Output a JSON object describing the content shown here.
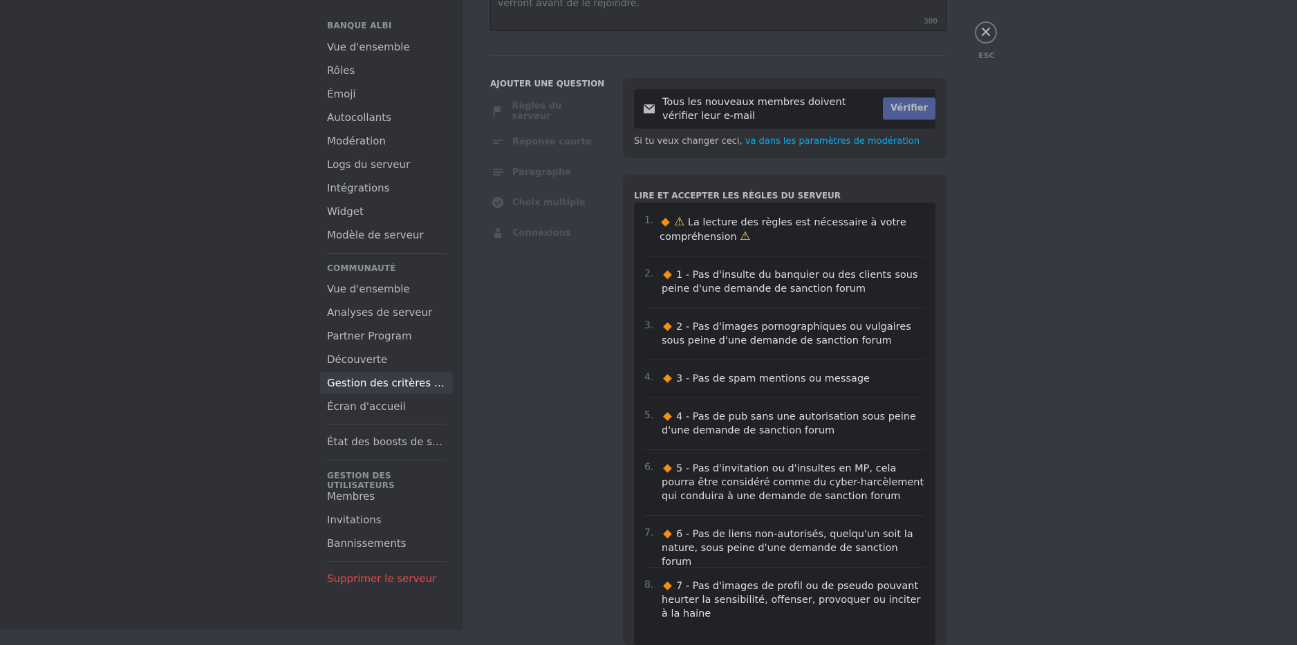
{
  "sidebar": {
    "sections": [
      {
        "header": "BANQUE ALBI",
        "items": [
          "Vue d'ensemble",
          "Rôles",
          "Émoji",
          "Autocollants",
          "Modération",
          "Logs du serveur",
          "Intégrations",
          "Widget",
          "Modèle de serveur"
        ]
      },
      {
        "header": "COMMUNAUTÉ",
        "items": [
          "Vue d'ensemble",
          "Analyses de serveur",
          "Partner Program",
          "Découverte",
          "Gestion des critères de ...",
          "Écran d'accueil"
        ]
      },
      {
        "items": [
          "État des boosts de serveur"
        ]
      },
      {
        "header": "GESTION DES UTILISATEURS",
        "items": [
          "Membres",
          "Invitations",
          "Bannissements"
        ]
      },
      {
        "items": [
          "Supprimer le serveur"
        ]
      }
    ],
    "active_item": "Gestion des critères de ..."
  },
  "description": {
    "text": "verront avant de le rejoindre.",
    "char_count": "300"
  },
  "add_question": {
    "header": "AJOUTER UNE QUESTION",
    "types": [
      {
        "label": "Règles du serveur",
        "icon": "flag-icon"
      },
      {
        "label": "Réponse courte",
        "icon": "short-text-icon"
      },
      {
        "label": "Paragraphe",
        "icon": "paragraph-icon"
      },
      {
        "label": "Choix multiple",
        "icon": "check-circle-icon"
      },
      {
        "label": "Connexions",
        "icon": "connections-icon"
      }
    ]
  },
  "verify_card": {
    "text": "Tous les nouveaux membres doivent vérifier leur e-mail",
    "button": "Vérifier",
    "hint_prefix": "Si tu veux changer ceci, ",
    "hint_link": "va dans les paramètres de modération"
  },
  "rules": {
    "title": "LIRE ET ACCEPTER LES RÈGLES DU SERVEUR",
    "items": [
      {
        "num": "1.",
        "text": "La lecture des règles est nécessaire à votre compréhension"
      },
      {
        "num": "2.",
        "text": "1 - Pas d'insulte du banquier ou des clients sous peine d'une demande de sanction forum"
      },
      {
        "num": "3.",
        "text": "2 - Pas d'images pornographiques ou vulgaires sous peine d'une demande de sanction forum"
      },
      {
        "num": "4.",
        "text": "3 - Pas de spam mentions ou message"
      },
      {
        "num": "5.",
        "text": "4 - Pas de pub sans une autorisation sous peine d'une demande de sanction forum"
      },
      {
        "num": "6.",
        "text": "5 - Pas d'invitation ou d'insultes en MP, cela pourra être considéré comme du cyber-harcèlement qui conduira à une demande de sanction forum"
      },
      {
        "num": "7.",
        "text": "6 - Pas de liens non-autorisés, quelqu'un soit la nature, sous peine d'une demande de sanction forum"
      },
      {
        "num": "8.",
        "text": "7 - Pas d'images de profil ou de pseudo pouvant heurter la sensibilité, offenser, provoquer ou inciter à la haine"
      }
    ]
  },
  "close": {
    "esc_label": "ESC"
  },
  "colors": {
    "accent": "#4e5d94",
    "link": "#00aff4",
    "danger": "#f04747",
    "diamond": "#f4900c"
  }
}
